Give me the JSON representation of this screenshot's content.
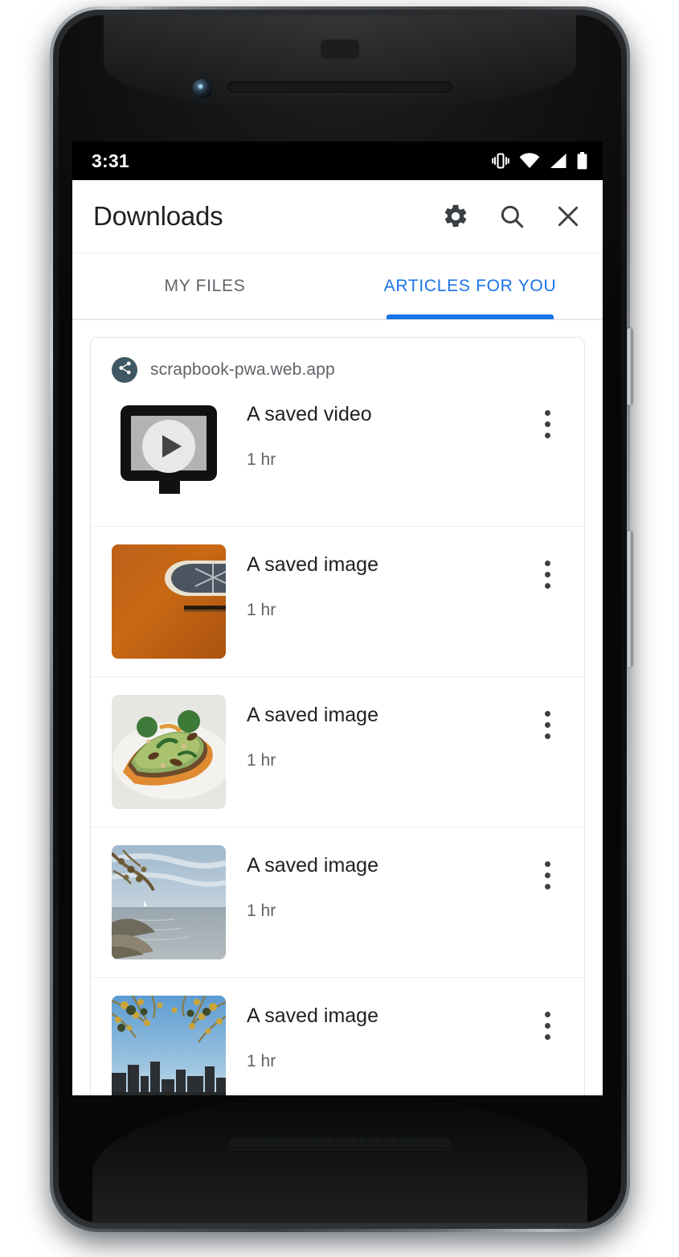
{
  "device": {
    "statusbar": {
      "time": "3:31",
      "icons": [
        "vibrate-icon",
        "wifi-icon",
        "signal-icon",
        "battery-icon"
      ]
    }
  },
  "appbar": {
    "title": "Downloads",
    "actions": [
      {
        "name": "settings-button",
        "icon": "gear-icon"
      },
      {
        "name": "search-button",
        "icon": "search-icon"
      },
      {
        "name": "close-button",
        "icon": "close-icon"
      }
    ]
  },
  "tabs": {
    "active_index": 1,
    "accent_color": "#1a73e8",
    "items": [
      {
        "label": "MY FILES"
      },
      {
        "label": "ARTICLES FOR YOU"
      }
    ]
  },
  "card": {
    "domain": "scrapbook-pwa.web.app",
    "favicon_icon": "share-icon",
    "favicon_color": "#3f5762",
    "rows": [
      {
        "title": "A saved video",
        "time": "1 hr",
        "thumb": "video-placeholder",
        "menu": "overflow-menu-icon"
      },
      {
        "title": "A saved image",
        "time": "1 hr",
        "thumb": "orange-wall-window",
        "menu": "overflow-menu-icon"
      },
      {
        "title": "A saved image",
        "time": "1 hr",
        "thumb": "avocado-toast",
        "menu": "overflow-menu-icon"
      },
      {
        "title": "A saved image",
        "time": "1 hr",
        "thumb": "lake-shore",
        "menu": "overflow-menu-icon"
      },
      {
        "title": "A saved image",
        "time": "1 hr",
        "thumb": "city-skyline-autumn",
        "menu": "overflow-menu-icon"
      }
    ]
  }
}
